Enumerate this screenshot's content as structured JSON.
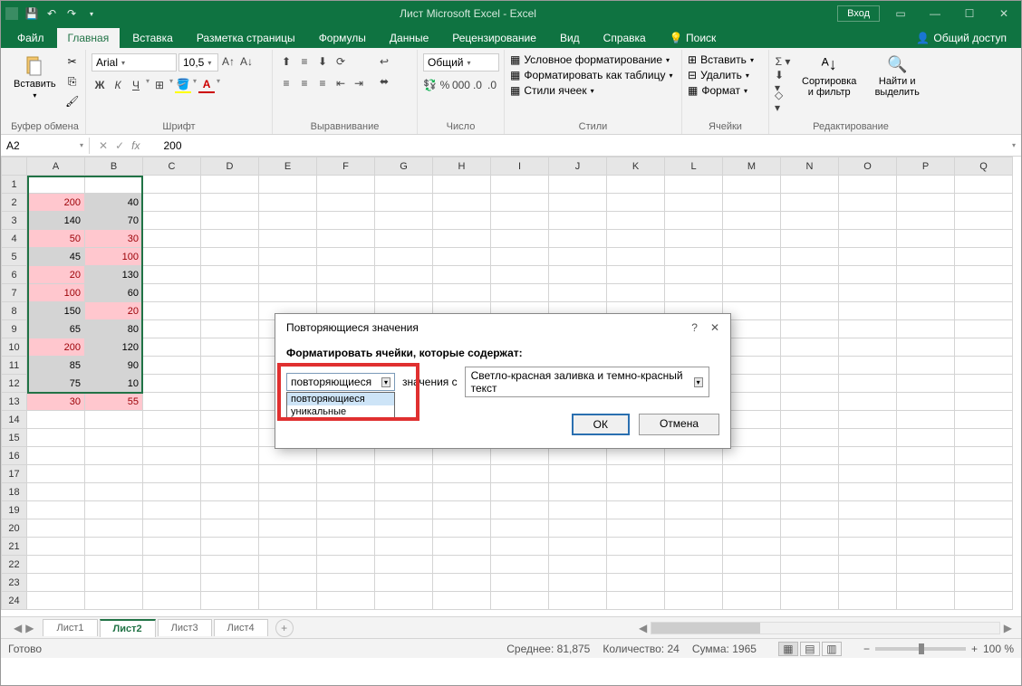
{
  "title": "Лист Microsoft Excel  -  Excel",
  "login": "Вход",
  "tabs": [
    "Файл",
    "Главная",
    "Вставка",
    "Разметка страницы",
    "Формулы",
    "Данные",
    "Рецензирование",
    "Вид",
    "Справка",
    "Поиск"
  ],
  "active_tab": 1,
  "share": "Общий доступ",
  "ribbon": {
    "clipboard": {
      "paste": "Вставить",
      "label": "Буфер обмена"
    },
    "font": {
      "name": "Arial",
      "size": "10,5",
      "label": "Шрифт",
      "bold": "Ж",
      "italic": "К",
      "underline": "Ч"
    },
    "alignment": {
      "label": "Выравнивание"
    },
    "number": {
      "format": "Общий",
      "label": "Число"
    },
    "styles": {
      "cond": "Условное форматирование",
      "table": "Форматировать как таблицу",
      "cell": "Стили ячеек",
      "label": "Стили"
    },
    "cells": {
      "insert": "Вставить",
      "delete": "Удалить",
      "format": "Формат",
      "label": "Ячейки"
    },
    "editing": {
      "sort": "Сортировка и фильтр",
      "find": "Найти и выделить",
      "label": "Редактирование"
    }
  },
  "namebox": "A2",
  "formula": "200",
  "columns": [
    "A",
    "B",
    "C",
    "D",
    "E",
    "F",
    "G",
    "H",
    "I",
    "J",
    "K",
    "L",
    "M",
    "N",
    "O",
    "P",
    "Q"
  ],
  "rows": 35,
  "data": {
    "A": [
      null,
      200,
      140,
      50,
      45,
      20,
      100,
      150,
      65,
      200,
      85,
      75,
      30
    ],
    "B": [
      null,
      40,
      70,
      30,
      100,
      130,
      60,
      20,
      80,
      120,
      90,
      10,
      55
    ]
  },
  "dup_red_cells": [
    "A2",
    "A4",
    "A6",
    "A7",
    "A10",
    "A13",
    "B4",
    "B5",
    "B8",
    "B13"
  ],
  "sheets": [
    "Лист1",
    "Лист2",
    "Лист3",
    "Лист4"
  ],
  "active_sheet": 1,
  "status": {
    "ready": "Готово",
    "avg_label": "Среднее:",
    "avg": "81,875",
    "count_label": "Количество:",
    "count": "24",
    "sum_label": "Сумма:",
    "sum": "1965",
    "zoom": "100 %"
  },
  "dialog": {
    "title": "Повторяющиеся значения",
    "label": "Форматировать ячейки, которые содержат:",
    "combo_value": "повторяющиеся",
    "options": [
      "повторяющиеся",
      "уникальные"
    ],
    "mid": "значения с",
    "format": "Светло-красная заливка и темно-красный текст",
    "ok": "ОК",
    "cancel": "Отмена"
  }
}
